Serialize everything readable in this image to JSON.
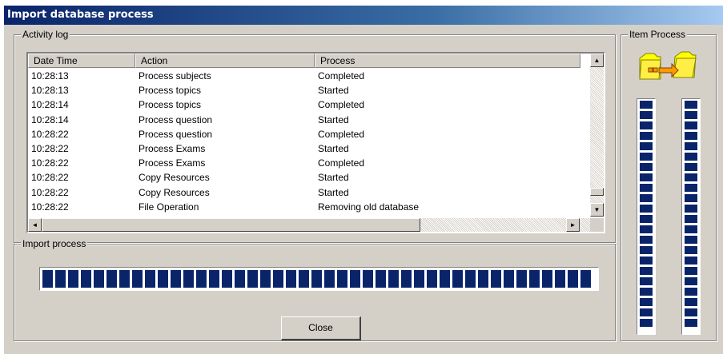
{
  "window": {
    "title": "Import database process"
  },
  "activity_log": {
    "label": "Activity log",
    "columns": [
      "Date Time",
      "Action",
      "Process"
    ],
    "rows": [
      [
        "10:28:13",
        "Process subjects",
        "Completed"
      ],
      [
        "10:28:13",
        "Process topics",
        "Started"
      ],
      [
        "10:28:14",
        "Process topics",
        "Completed"
      ],
      [
        "10:28:14",
        "Process question",
        "Started"
      ],
      [
        "10:28:22",
        "Process question",
        "Completed"
      ],
      [
        "10:28:22",
        "Process Exams",
        "Started"
      ],
      [
        "10:28:22",
        "Process Exams",
        "Completed"
      ],
      [
        "10:28:22",
        "Copy Resources",
        "Started"
      ],
      [
        "10:28:22",
        "Copy Resources",
        "Started"
      ],
      [
        "10:28:22",
        "File Operation",
        "Removing old database"
      ]
    ],
    "icons": {
      "scroll_up": "arrow-up-icon",
      "scroll_down": "arrow-down-icon",
      "scroll_left": "arrow-left-icon",
      "scroll_right": "arrow-right-icon"
    }
  },
  "import_process": {
    "label": "Import process",
    "progress": 1.0
  },
  "item_process": {
    "label": "Item Process",
    "icon": "folder-transfer-icon",
    "left_bar_progress": 1.0,
    "right_bar_progress": 1.0
  },
  "buttons": {
    "close": "Close"
  },
  "colors": {
    "progress_block": "#0a246a",
    "titlebar": "#0a246a",
    "window_bg": "#d4d0c8"
  }
}
